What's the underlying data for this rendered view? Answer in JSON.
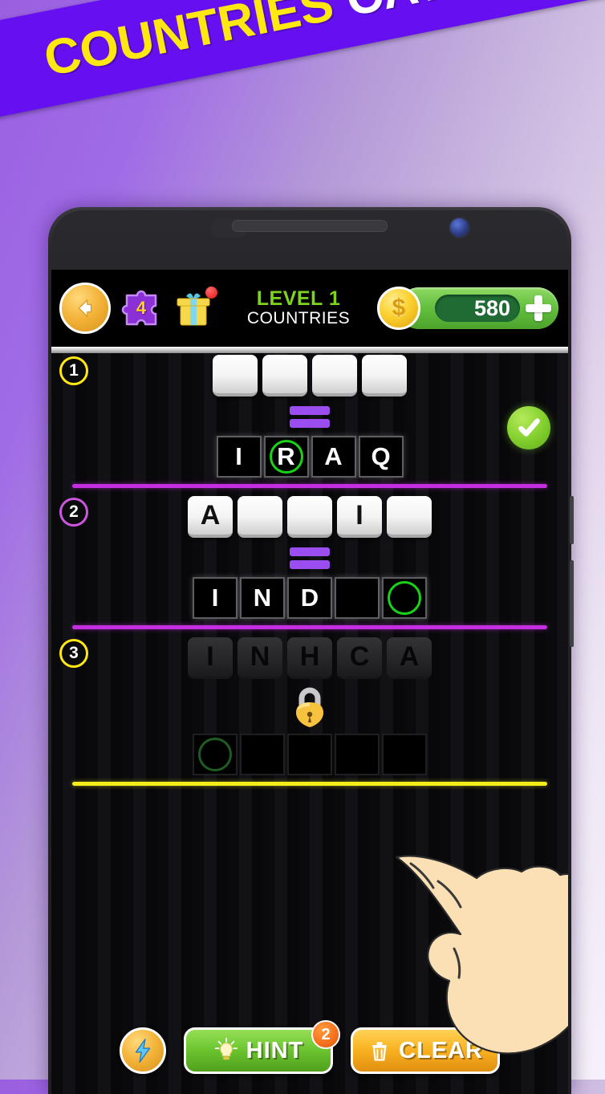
{
  "banner": {
    "word1": "COUNTRIES",
    "word2": "CATEGORY",
    "bg_color": "#6610f2",
    "word1_color": "#ffe812",
    "word2_color": "#ffffff"
  },
  "header": {
    "back_icon": "back-arrow-icon",
    "puzzle_icon": "puzzle-piece-icon",
    "puzzle_count": "4",
    "gift_icon": "gift-box-icon",
    "gift_has_notification": true,
    "level_label": "LEVEL 1",
    "category_label": "COUNTRIES",
    "level_color": "#7ed321",
    "coin_icon": "coin-icon",
    "coin_symbol": "$",
    "coin_amount": "580",
    "add_coins_icon": "plus-icon"
  },
  "rows": [
    {
      "number": "1",
      "badge_color": "#ffe812",
      "state": "solved",
      "scramble": [
        "",
        "",
        "",
        ""
      ],
      "answer": [
        "I",
        "R",
        "A",
        "Q"
      ],
      "cursor_index": 1,
      "has_check": true,
      "check_icon": "check-icon",
      "divider_color": "#c42ee0"
    },
    {
      "number": "2",
      "badge_color": "#cc55dd",
      "state": "active",
      "scramble": [
        "A",
        "",
        "",
        "I",
        ""
      ],
      "answer": [
        "I",
        "N",
        "D",
        "",
        ""
      ],
      "cursor_index": 4,
      "has_check": false,
      "divider_color": "#c42ee0"
    },
    {
      "number": "3",
      "badge_color": "#ffe812",
      "state": "locked",
      "scramble": [
        "I",
        "N",
        "H",
        "C",
        "A"
      ],
      "answer": [
        "",
        "",
        "",
        "",
        ""
      ],
      "cursor_index": 0,
      "lock_icon": "padlock-icon",
      "has_check": false,
      "divider_color": "#f3ed1c"
    }
  ],
  "pointer": {
    "icon": "pointing-hand-icon",
    "target": "row-2-scramble-tile-5"
  },
  "footer": {
    "boost_icon": "lightning-bolt-icon",
    "hint_label": "HINT",
    "hint_icon": "lightbulb-icon",
    "hint_count": "2",
    "clear_label": "CLEAR",
    "clear_icon": "trash-icon"
  }
}
